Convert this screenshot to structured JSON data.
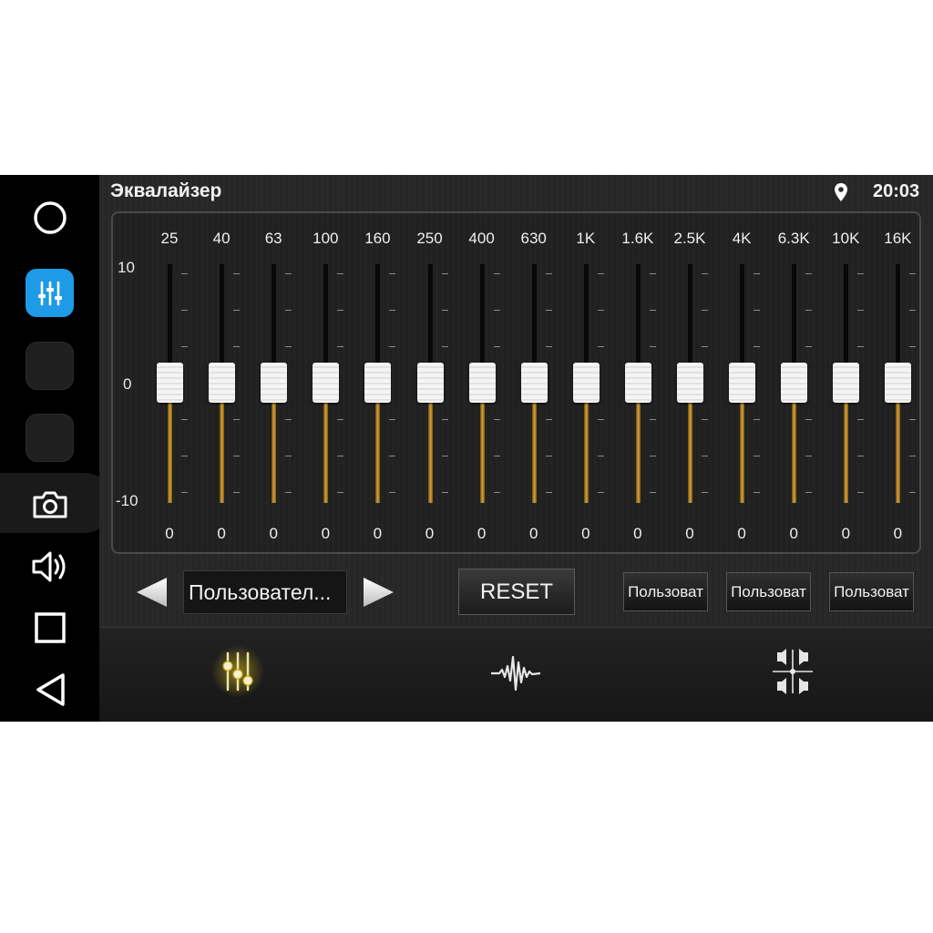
{
  "app": {
    "title": "Эквалайзер",
    "time": "20:03"
  },
  "colors": {
    "accent_blue": "#1e9be6",
    "slider_fill": "#d8a33a",
    "active_tab_glow": "#e6c81e"
  },
  "system_bar": {
    "items": [
      {
        "name": "home-circle-icon"
      },
      {
        "name": "equalizer-app-icon"
      },
      {
        "name": "blank-app-slot"
      },
      {
        "name": "blank-app-slot"
      },
      {
        "name": "camera-icon"
      },
      {
        "name": "volume-icon"
      },
      {
        "name": "recents-square-icon"
      },
      {
        "name": "back-triangle-icon"
      }
    ]
  },
  "equalizer": {
    "scale": {
      "top": "10",
      "mid": "0",
      "bottom": "-10"
    },
    "bands": [
      {
        "freq": "25",
        "value": "0"
      },
      {
        "freq": "40",
        "value": "0"
      },
      {
        "freq": "63",
        "value": "0"
      },
      {
        "freq": "100",
        "value": "0"
      },
      {
        "freq": "160",
        "value": "0"
      },
      {
        "freq": "250",
        "value": "0"
      },
      {
        "freq": "400",
        "value": "0"
      },
      {
        "freq": "630",
        "value": "0"
      },
      {
        "freq": "1K",
        "value": "0"
      },
      {
        "freq": "1.6K",
        "value": "0"
      },
      {
        "freq": "2.5K",
        "value": "0"
      },
      {
        "freq": "4K",
        "value": "0"
      },
      {
        "freq": "6.3K",
        "value": "0"
      },
      {
        "freq": "10K",
        "value": "0"
      },
      {
        "freq": "16K",
        "value": "0"
      }
    ]
  },
  "controls": {
    "preset_name": "Пользовател...",
    "reset_label": "RESET",
    "user_presets": [
      "Пользоват",
      "Пользоват",
      "Пользоват"
    ]
  },
  "tabs": [
    {
      "icon": "equalizer-sliders-icon",
      "active": true
    },
    {
      "icon": "sound-wave-icon",
      "active": false
    },
    {
      "icon": "speaker-balance-icon",
      "active": false
    }
  ]
}
